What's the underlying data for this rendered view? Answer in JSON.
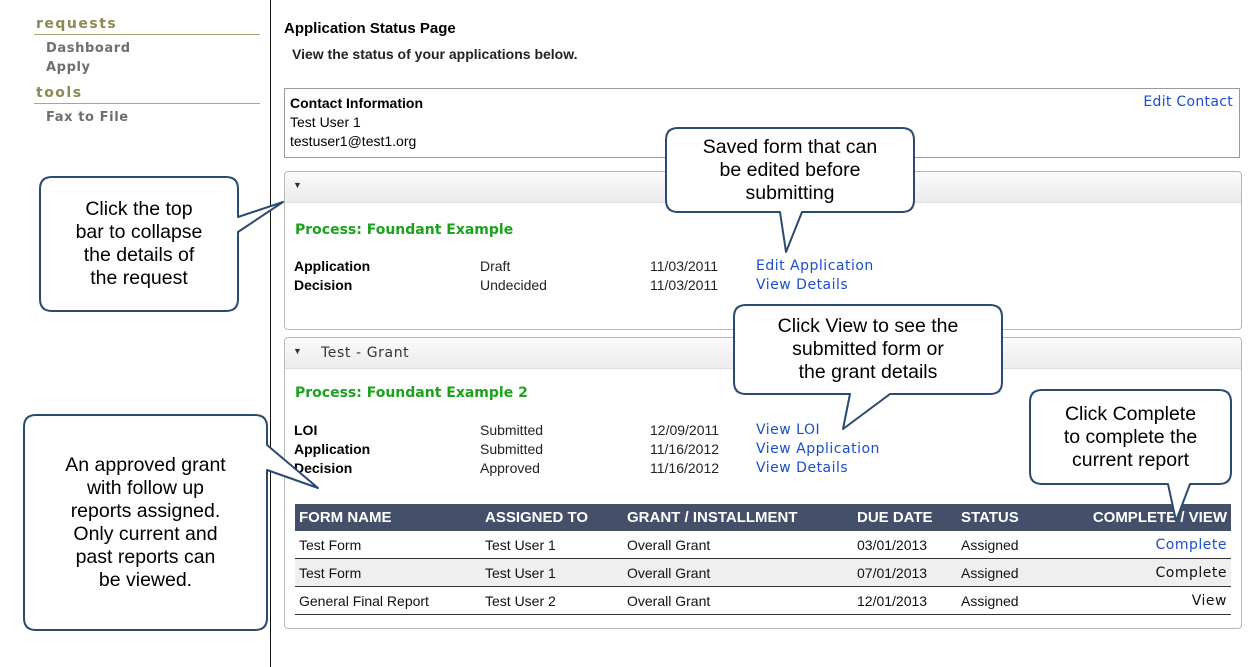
{
  "sidebar": {
    "sections": [
      {
        "heading": "requests",
        "links": [
          "Dashboard",
          "Apply"
        ]
      },
      {
        "heading": "tools",
        "links": [
          "Fax to File"
        ]
      }
    ]
  },
  "header": {
    "title": "Application Status Page",
    "subtitle": "View the status of your applications below."
  },
  "contact": {
    "title": "Contact Information",
    "name": "Test User 1",
    "email": "testuser1@test1.org",
    "edit_label": "Edit Contact"
  },
  "panel1": {
    "name": "",
    "process": "Process: Foundant Example",
    "rows": [
      {
        "type": "Application",
        "status": "Draft",
        "date": "11/03/2011",
        "action": "Edit Application"
      },
      {
        "type": "Decision",
        "status": "Undecided",
        "date": "11/03/2011",
        "action": "View Details"
      }
    ]
  },
  "panel2": {
    "name": "Test - Grant",
    "process": "Process: Foundant Example 2",
    "rows": [
      {
        "type": "LOI",
        "status": "Submitted",
        "date": "12/09/2011",
        "action": "View LOI"
      },
      {
        "type": "Application",
        "status": "Submitted",
        "date": "11/16/2012",
        "action": "View Application"
      },
      {
        "type": "Decision",
        "status": "Approved",
        "date": "11/16/2012",
        "action": "View Details"
      }
    ],
    "table": {
      "headers": [
        "FORM NAME",
        "ASSIGNED TO",
        "GRANT / INSTALLMENT",
        "DUE DATE",
        "STATUS",
        "COMPLETE / VIEW"
      ],
      "rows": [
        [
          "Test Form",
          "Test User 1",
          "Overall Grant",
          "03/01/2013",
          "Assigned",
          "Complete"
        ],
        [
          "Test Form",
          "Test User 1",
          "Overall Grant",
          "07/01/2013",
          "Assigned",
          "Complete"
        ],
        [
          "General Final Report",
          "Test User 2",
          "Overall Grant",
          "12/01/2013",
          "Assigned",
          "View"
        ]
      ]
    }
  },
  "callouts": {
    "saved_form": "Saved form that can\nbe edited before\nsubmitting",
    "top_bar": "Click the top\nbar to collapse\nthe details of\nthe request",
    "click_view": "Click View to see the\nsubmitted form or\nthe grant details",
    "click_complete": "Click Complete\nto complete the\ncurrent report",
    "approved_grant": "An approved grant\nwith follow up\nreports assigned.\nOnly current and\npast reports can\nbe viewed."
  },
  "colors": {
    "accent_link": "#1a4ecf",
    "process_green": "#1aa31a",
    "table_header": "#44506a",
    "sidebar_heading": "#8a8a52"
  }
}
